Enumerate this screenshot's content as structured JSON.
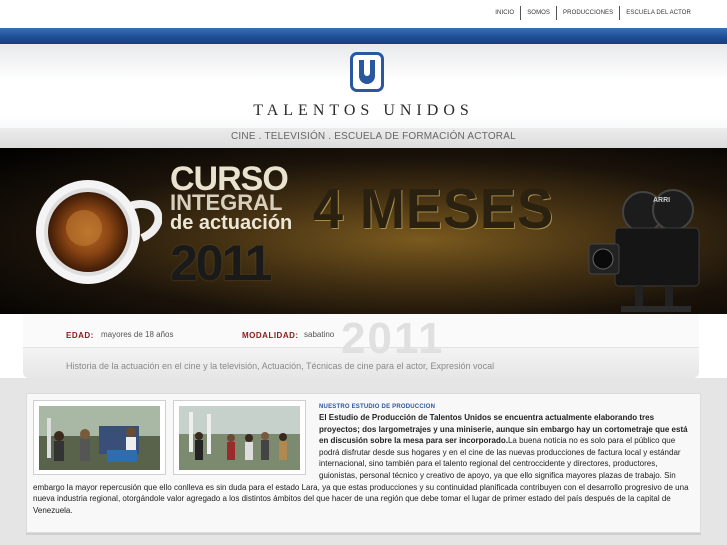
{
  "nav": {
    "items": [
      "INICIO",
      "SOMOS",
      "PRODUCCIONES",
      "ESCUELA DEL ACTOR"
    ]
  },
  "header": {
    "logo_icon": "talentos-unidos-logo",
    "brand": "TALENTOS UNIDOS",
    "subline": "CINE  .  TELEVISIÓN  .  ESCUELA DE FORMACIÓN ACTORAL"
  },
  "banner": {
    "line1": "CURSO",
    "line2": "INTEGRAL",
    "line3": "de actuación",
    "year": "2011",
    "duration": "4 MESES",
    "watermark_year": "2011",
    "camera_brand": "ARRI"
  },
  "info": {
    "edad_label": "EDAD:",
    "edad_value": "mayores de 18 años",
    "modalidad_label": "MODALIDAD:",
    "modalidad_value": "sabatino",
    "topics": "Historia de la actuación en el cine y la televisión, Actuación, Técnicas de cine para el actor, Expresión vocal"
  },
  "content": {
    "section_title": "NUESTRO ESTUDIO DE PRODUCCION",
    "bold_text": "El Estudio de Producción de Talentos Unidos se encuentra actualmente elaborando tres proyectos; dos largometrajes y una miniserie, aunque sin embargo hay un cortometraje que está en discusión sobre la mesa para ser incorporado.",
    "body_text": "La buena noticia no es solo para el público que podrá disfrutar desde sus hogares y en el cine de las nuevas producciones de factura local y estándar internacional, sino también para el talento regional del centroccidente y directores, productores, guionistas, personal técnico y creativo de apoyo, ya que ello significa mayores plazas de trabajo. Sin embargo la mayor repercusión que ello conlleva es sin duda para el estado Lara, ya que estas producciones y su continuidad planificada contribuyen con el desarrollo progresivo de una nueva industria regional, otorgándole valor agregado a los distintos ámbitos del que hacer de una región que debe tomar el lugar de primer estado del país después de la capital de Venezuela."
  },
  "colors": {
    "brand_blue": "#2a57a0",
    "label_red": "#8b1a1a",
    "section_blue": "#2a57a0"
  }
}
